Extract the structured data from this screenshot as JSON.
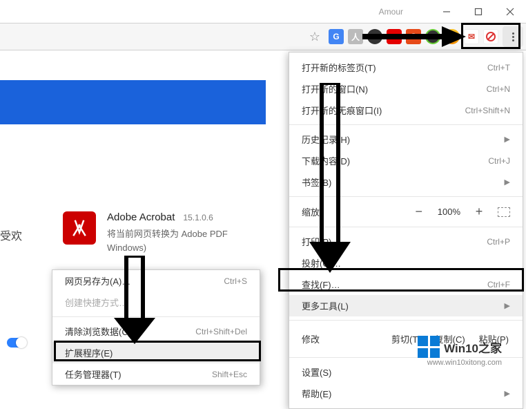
{
  "window": {
    "title": "Amour"
  },
  "toolbar": {
    "icons": [
      "google-translate",
      "pdf",
      "mask",
      "adblock",
      "office",
      "evernote",
      "pinterest",
      "rss",
      "sync",
      "menu"
    ]
  },
  "main_menu": {
    "new_tab": {
      "label": "打开新的标签页(T)",
      "shortcut": "Ctrl+T"
    },
    "new_window": {
      "label": "打开新的窗口(N)",
      "shortcut": "Ctrl+N"
    },
    "incognito": {
      "label": "打开新的无痕窗口(I)",
      "shortcut": "Ctrl+Shift+N"
    },
    "history": {
      "label": "历史记录(H)"
    },
    "downloads": {
      "label": "下载内容(D)",
      "shortcut": "Ctrl+J"
    },
    "bookmarks": {
      "label": "书签(B)"
    },
    "zoom": {
      "label": "缩放",
      "minus": "−",
      "value": "100%",
      "plus": "+"
    },
    "print": {
      "label": "打印(P)…",
      "shortcut": "Ctrl+P"
    },
    "cast": {
      "label": "投射(C)…"
    },
    "find": {
      "label": "查找(F)…",
      "shortcut": "Ctrl+F"
    },
    "more_tools": {
      "label": "更多工具(L)"
    },
    "edit": {
      "label": "修改",
      "cut": "剪切(T)",
      "copy": "复制(C)",
      "paste": "粘贴(P)"
    },
    "settings": {
      "label": "设置(S)"
    },
    "help": {
      "label": "帮助(E)"
    }
  },
  "ext_menu": {
    "save_as": {
      "label": "网页另存为(A)…",
      "shortcut": "Ctrl+S"
    },
    "create_shortcut": {
      "label": "创建快捷方式…"
    },
    "clear_data": {
      "label": "清除浏览数据(C)…",
      "shortcut": "Ctrl+Shift+Del"
    },
    "extensions": {
      "label": "扩展程序(E)"
    },
    "task_mgr": {
      "label": "任务管理器(T)",
      "shortcut": "Shift+Esc"
    }
  },
  "apps_card": {
    "title": "Adobe Acrobat",
    "version": "15.1.0.6",
    "desc_l1": "将当前网页转换为 Adobe PDF",
    "desc_l2": "Windows)"
  },
  "left_label": "受欢",
  "logo": {
    "text1": "Win10",
    "text2": "之家",
    "url": "www.win10xitong.com"
  }
}
